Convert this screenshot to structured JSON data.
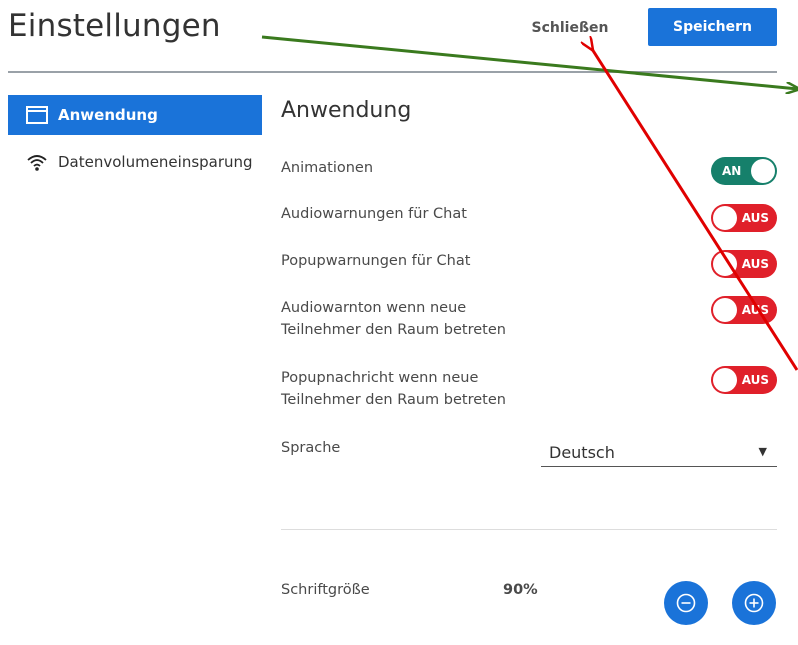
{
  "header": {
    "title": "Einstellungen",
    "close_label": "Schließen",
    "save_label": "Speichern"
  },
  "sidebar": {
    "items": [
      {
        "label": "Anwendung",
        "icon": "window-icon",
        "active": true
      },
      {
        "label": "Datenvolumeneinsparung",
        "icon": "wifi-icon",
        "active": false
      }
    ]
  },
  "main": {
    "section_title": "Anwendung",
    "settings": [
      {
        "label": "Animationen",
        "state": "AN"
      },
      {
        "label": "Audiowarnungen für Chat",
        "state": "AUS"
      },
      {
        "label": "Popupwarnungen für Chat",
        "state": "AUS"
      },
      {
        "label": "Audiowarnton wenn neue Teilnehmer den Raum betreten",
        "state": "AUS"
      },
      {
        "label": "Popupnachricht wenn neue Teilnehmer den Raum betreten",
        "state": "AUS"
      }
    ],
    "language": {
      "label": "Sprache",
      "value": "Deutsch"
    },
    "font_size": {
      "label": "Schriftgröße",
      "value": "90%"
    }
  },
  "colors": {
    "accent": "#1a73d9",
    "toggle_on": "#16806b",
    "toggle_off": "#e0202a",
    "annotation_green": "#3a7a1e",
    "annotation_red": "#e00000"
  }
}
